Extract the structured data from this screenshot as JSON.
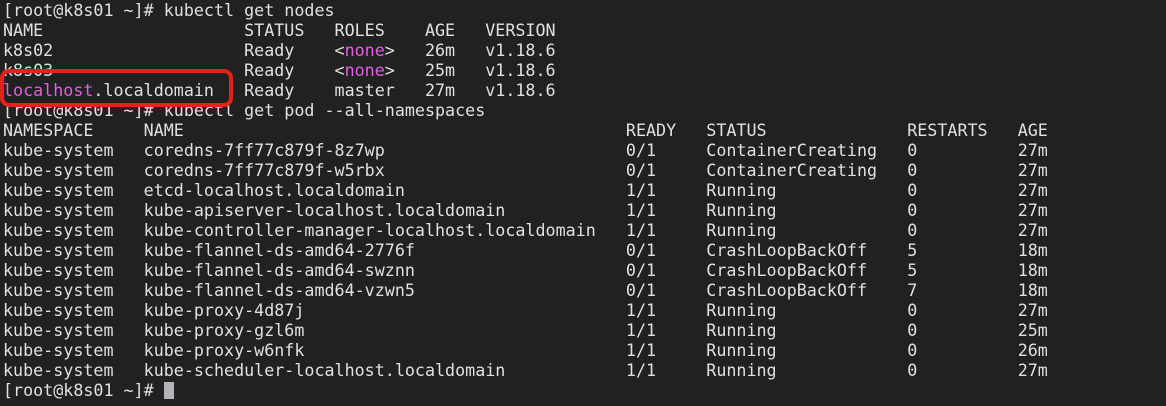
{
  "colors": {
    "background": "#212121",
    "foreground": "#e0e0e0",
    "magenta": "#e15fe1",
    "annotation_red": "#e3231b",
    "cursor": "#b3b3bb"
  },
  "terminal": {
    "prompt": "[root@k8s01 ~]#",
    "commands": {
      "get_nodes": "kubectl get nodes",
      "get_pods": "kubectl get pod --all-namespaces"
    },
    "nodes_table": {
      "headers": [
        "NAME",
        "STATUS",
        "ROLES",
        "AGE",
        "VERSION"
      ],
      "col_starts": [
        0,
        24,
        33,
        42,
        48
      ],
      "rows": [
        {
          "name": "k8s02",
          "status": "Ready",
          "roles": [
            {
              "t": "<"
            },
            {
              "t": "none",
              "c": "magenta"
            },
            {
              "t": ">"
            }
          ],
          "age": "26m",
          "version": "v1.18.6"
        },
        {
          "name": "k8s03",
          "status": "Ready",
          "roles": [
            {
              "t": "<"
            },
            {
              "t": "none",
              "c": "magenta"
            },
            {
              "t": ">"
            }
          ],
          "age": "25m",
          "version": "v1.18.6"
        },
        {
          "name": [
            {
              "t": "localhost",
              "c": "magenta"
            },
            {
              "t": ".localdomain"
            }
          ],
          "status": "Ready",
          "roles": "master",
          "age": "27m",
          "version": "v1.18.6"
        }
      ]
    },
    "pods_table": {
      "headers": [
        "NAMESPACE",
        "NAME",
        "READY",
        "STATUS",
        "RESTARTS",
        "AGE"
      ],
      "col_starts": [
        0,
        14,
        62,
        70,
        90,
        101
      ],
      "rows": [
        {
          "namespace": "kube-system",
          "name": "coredns-7ff77c879f-8z7wp",
          "ready": "0/1",
          "status": "ContainerCreating",
          "restarts": "0",
          "age": "27m"
        },
        {
          "namespace": "kube-system",
          "name": "coredns-7ff77c879f-w5rbx",
          "ready": "0/1",
          "status": "ContainerCreating",
          "restarts": "0",
          "age": "27m"
        },
        {
          "namespace": "kube-system",
          "name": "etcd-localhost.localdomain",
          "ready": "1/1",
          "status": "Running",
          "restarts": "0",
          "age": "27m"
        },
        {
          "namespace": "kube-system",
          "name": "kube-apiserver-localhost.localdomain",
          "ready": "1/1",
          "status": "Running",
          "restarts": "0",
          "age": "27m"
        },
        {
          "namespace": "kube-system",
          "name": "kube-controller-manager-localhost.localdomain",
          "ready": "1/1",
          "status": "Running",
          "restarts": "0",
          "age": "27m"
        },
        {
          "namespace": "kube-system",
          "name": "kube-flannel-ds-amd64-2776f",
          "ready": "0/1",
          "status": "CrashLoopBackOff",
          "restarts": "5",
          "age": "18m"
        },
        {
          "namespace": "kube-system",
          "name": "kube-flannel-ds-amd64-swznn",
          "ready": "0/1",
          "status": "CrashLoopBackOff",
          "restarts": "5",
          "age": "18m"
        },
        {
          "namespace": "kube-system",
          "name": "kube-flannel-ds-amd64-vzwn5",
          "ready": "0/1",
          "status": "CrashLoopBackOff",
          "restarts": "7",
          "age": "18m"
        },
        {
          "namespace": "kube-system",
          "name": "kube-proxy-4d87j",
          "ready": "1/1",
          "status": "Running",
          "restarts": "0",
          "age": "27m"
        },
        {
          "namespace": "kube-system",
          "name": "kube-proxy-gzl6m",
          "ready": "1/1",
          "status": "Running",
          "restarts": "0",
          "age": "25m"
        },
        {
          "namespace": "kube-system",
          "name": "kube-proxy-w6nfk",
          "ready": "1/1",
          "status": "Running",
          "restarts": "0",
          "age": "26m"
        },
        {
          "namespace": "kube-system",
          "name": "kube-scheduler-localhost.localdomain",
          "ready": "1/1",
          "status": "Running",
          "restarts": "0",
          "age": "27m"
        }
      ]
    },
    "annotation": {
      "shape": "rectangle",
      "color": "red",
      "around": "localhost.localdomain"
    }
  }
}
